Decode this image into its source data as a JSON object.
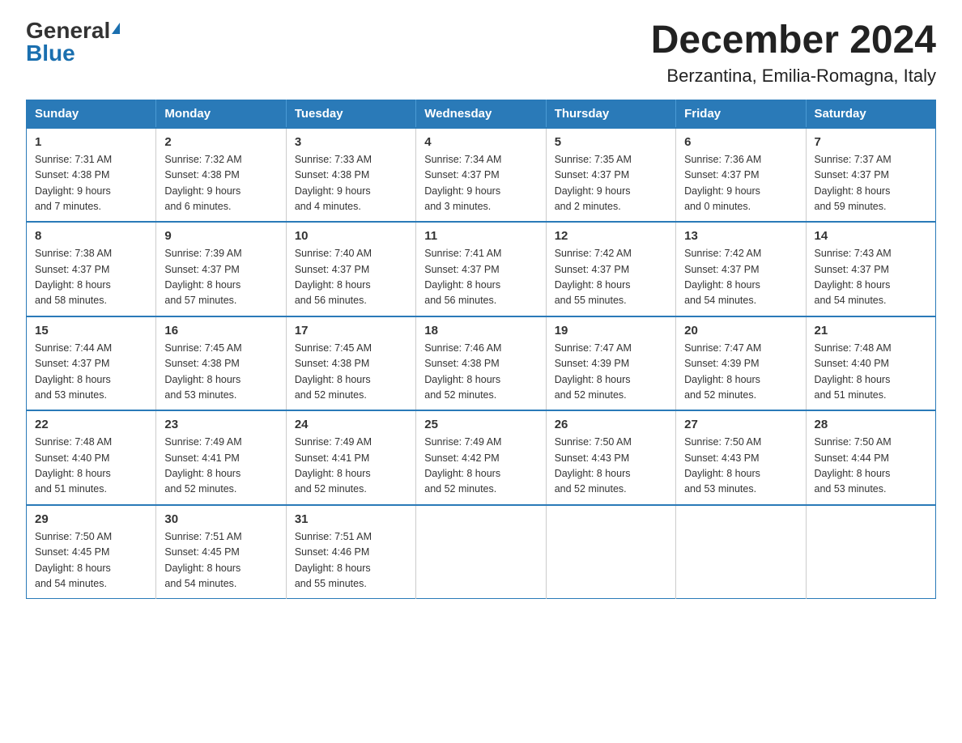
{
  "logo": {
    "general": "General",
    "blue": "Blue"
  },
  "title": "December 2024",
  "subtitle": "Berzantina, Emilia-Romagna, Italy",
  "days": [
    "Sunday",
    "Monday",
    "Tuesday",
    "Wednesday",
    "Thursday",
    "Friday",
    "Saturday"
  ],
  "weeks": [
    [
      {
        "num": "1",
        "info": "Sunrise: 7:31 AM\nSunset: 4:38 PM\nDaylight: 9 hours\nand 7 minutes."
      },
      {
        "num": "2",
        "info": "Sunrise: 7:32 AM\nSunset: 4:38 PM\nDaylight: 9 hours\nand 6 minutes."
      },
      {
        "num": "3",
        "info": "Sunrise: 7:33 AM\nSunset: 4:38 PM\nDaylight: 9 hours\nand 4 minutes."
      },
      {
        "num": "4",
        "info": "Sunrise: 7:34 AM\nSunset: 4:37 PM\nDaylight: 9 hours\nand 3 minutes."
      },
      {
        "num": "5",
        "info": "Sunrise: 7:35 AM\nSunset: 4:37 PM\nDaylight: 9 hours\nand 2 minutes."
      },
      {
        "num": "6",
        "info": "Sunrise: 7:36 AM\nSunset: 4:37 PM\nDaylight: 9 hours\nand 0 minutes."
      },
      {
        "num": "7",
        "info": "Sunrise: 7:37 AM\nSunset: 4:37 PM\nDaylight: 8 hours\nand 59 minutes."
      }
    ],
    [
      {
        "num": "8",
        "info": "Sunrise: 7:38 AM\nSunset: 4:37 PM\nDaylight: 8 hours\nand 58 minutes."
      },
      {
        "num": "9",
        "info": "Sunrise: 7:39 AM\nSunset: 4:37 PM\nDaylight: 8 hours\nand 57 minutes."
      },
      {
        "num": "10",
        "info": "Sunrise: 7:40 AM\nSunset: 4:37 PM\nDaylight: 8 hours\nand 56 minutes."
      },
      {
        "num": "11",
        "info": "Sunrise: 7:41 AM\nSunset: 4:37 PM\nDaylight: 8 hours\nand 56 minutes."
      },
      {
        "num": "12",
        "info": "Sunrise: 7:42 AM\nSunset: 4:37 PM\nDaylight: 8 hours\nand 55 minutes."
      },
      {
        "num": "13",
        "info": "Sunrise: 7:42 AM\nSunset: 4:37 PM\nDaylight: 8 hours\nand 54 minutes."
      },
      {
        "num": "14",
        "info": "Sunrise: 7:43 AM\nSunset: 4:37 PM\nDaylight: 8 hours\nand 54 minutes."
      }
    ],
    [
      {
        "num": "15",
        "info": "Sunrise: 7:44 AM\nSunset: 4:37 PM\nDaylight: 8 hours\nand 53 minutes."
      },
      {
        "num": "16",
        "info": "Sunrise: 7:45 AM\nSunset: 4:38 PM\nDaylight: 8 hours\nand 53 minutes."
      },
      {
        "num": "17",
        "info": "Sunrise: 7:45 AM\nSunset: 4:38 PM\nDaylight: 8 hours\nand 52 minutes."
      },
      {
        "num": "18",
        "info": "Sunrise: 7:46 AM\nSunset: 4:38 PM\nDaylight: 8 hours\nand 52 minutes."
      },
      {
        "num": "19",
        "info": "Sunrise: 7:47 AM\nSunset: 4:39 PM\nDaylight: 8 hours\nand 52 minutes."
      },
      {
        "num": "20",
        "info": "Sunrise: 7:47 AM\nSunset: 4:39 PM\nDaylight: 8 hours\nand 52 minutes."
      },
      {
        "num": "21",
        "info": "Sunrise: 7:48 AM\nSunset: 4:40 PM\nDaylight: 8 hours\nand 51 minutes."
      }
    ],
    [
      {
        "num": "22",
        "info": "Sunrise: 7:48 AM\nSunset: 4:40 PM\nDaylight: 8 hours\nand 51 minutes."
      },
      {
        "num": "23",
        "info": "Sunrise: 7:49 AM\nSunset: 4:41 PM\nDaylight: 8 hours\nand 52 minutes."
      },
      {
        "num": "24",
        "info": "Sunrise: 7:49 AM\nSunset: 4:41 PM\nDaylight: 8 hours\nand 52 minutes."
      },
      {
        "num": "25",
        "info": "Sunrise: 7:49 AM\nSunset: 4:42 PM\nDaylight: 8 hours\nand 52 minutes."
      },
      {
        "num": "26",
        "info": "Sunrise: 7:50 AM\nSunset: 4:43 PM\nDaylight: 8 hours\nand 52 minutes."
      },
      {
        "num": "27",
        "info": "Sunrise: 7:50 AM\nSunset: 4:43 PM\nDaylight: 8 hours\nand 53 minutes."
      },
      {
        "num": "28",
        "info": "Sunrise: 7:50 AM\nSunset: 4:44 PM\nDaylight: 8 hours\nand 53 minutes."
      }
    ],
    [
      {
        "num": "29",
        "info": "Sunrise: 7:50 AM\nSunset: 4:45 PM\nDaylight: 8 hours\nand 54 minutes."
      },
      {
        "num": "30",
        "info": "Sunrise: 7:51 AM\nSunset: 4:45 PM\nDaylight: 8 hours\nand 54 minutes."
      },
      {
        "num": "31",
        "info": "Sunrise: 7:51 AM\nSunset: 4:46 PM\nDaylight: 8 hours\nand 55 minutes."
      },
      null,
      null,
      null,
      null
    ]
  ]
}
